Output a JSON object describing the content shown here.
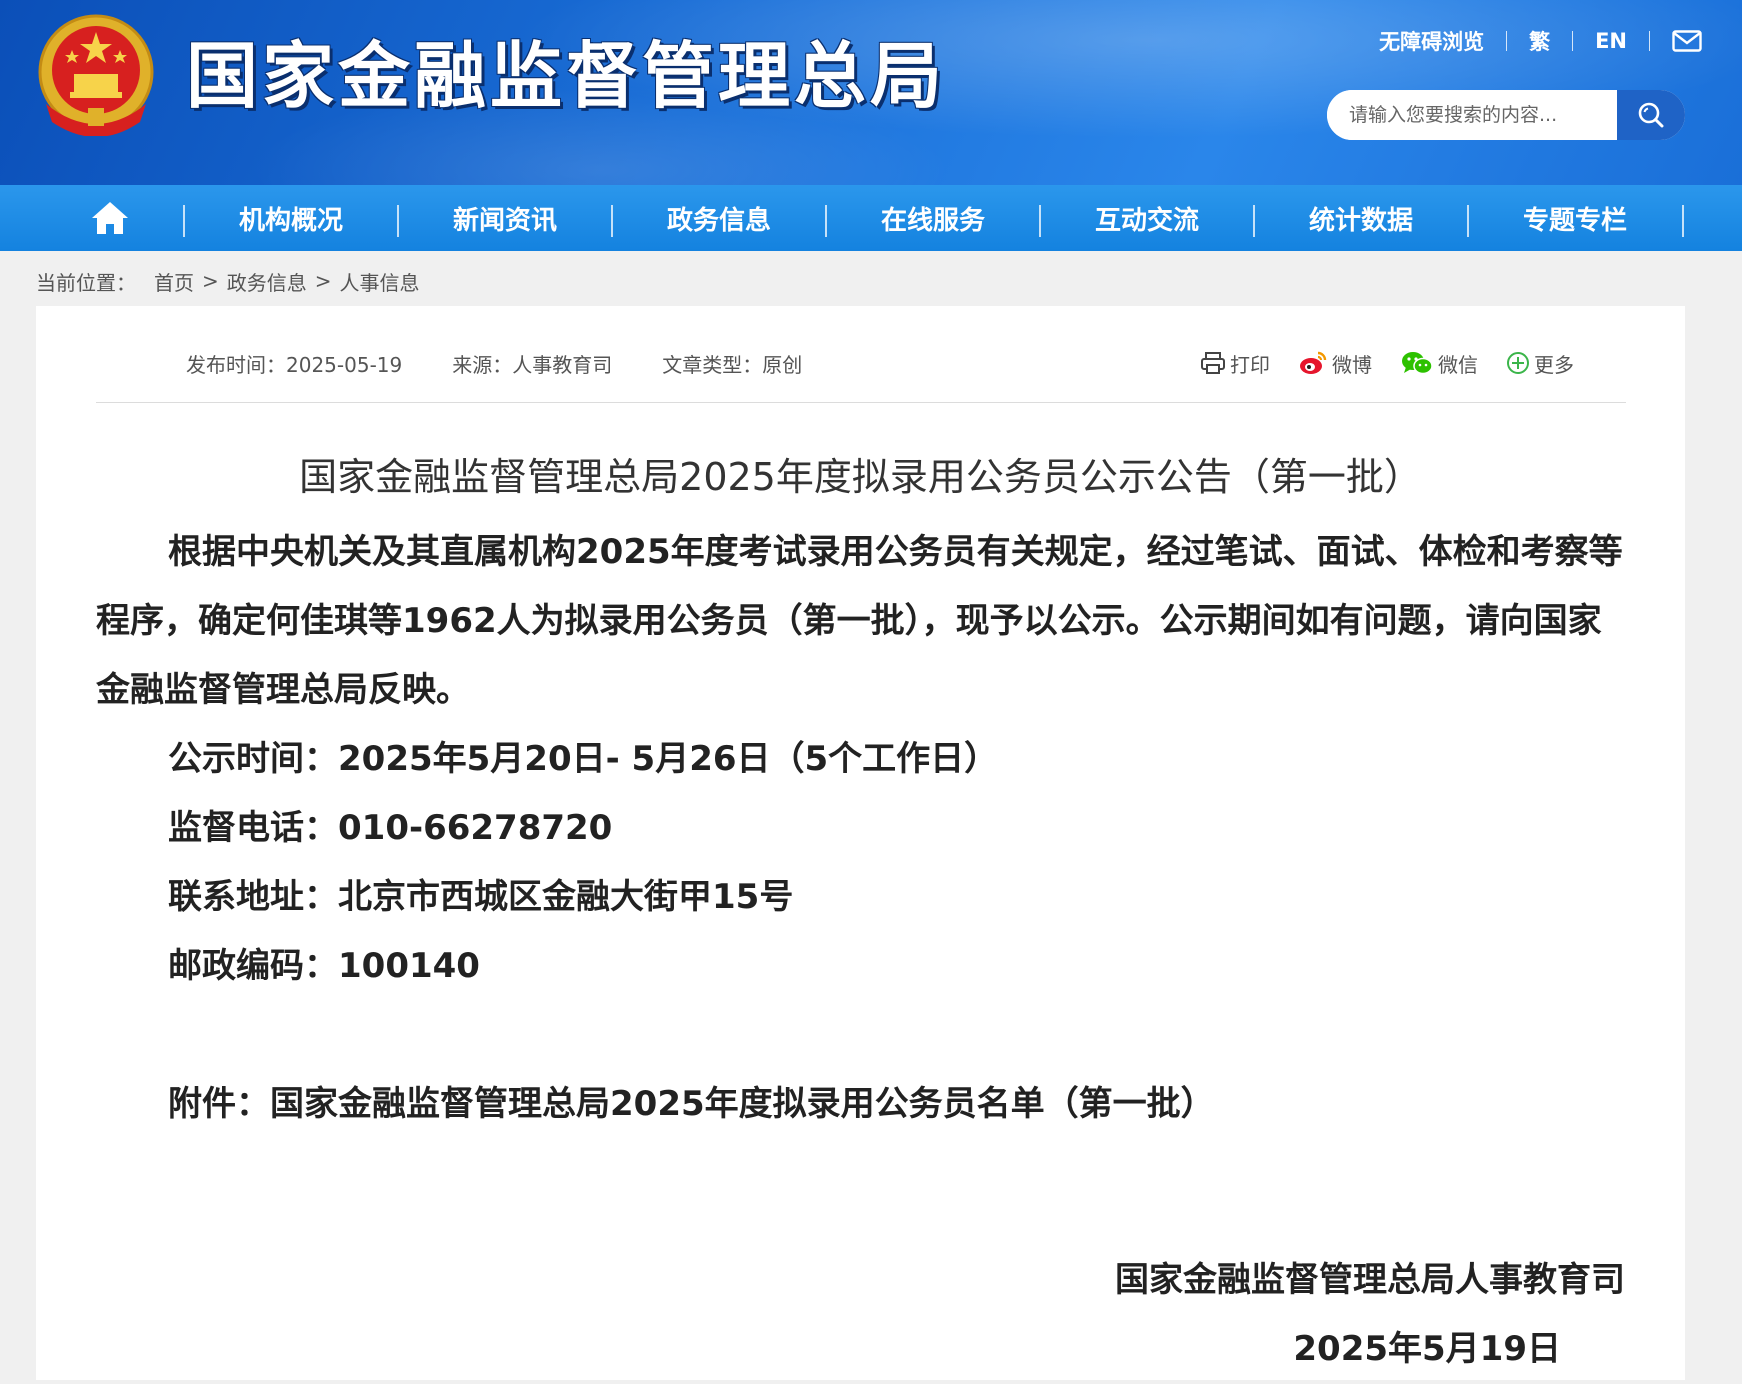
{
  "header": {
    "site_title": "国家金融监督管理总局",
    "links": {
      "accessibility": "无障碍浏览",
      "traditional": "繁",
      "english": "EN"
    },
    "search_placeholder": "请输入您要搜索的内容..."
  },
  "nav": {
    "home_icon": "home-icon",
    "items": [
      "机构概况",
      "新闻资讯",
      "政务信息",
      "在线服务",
      "互动交流",
      "统计数据",
      "专题专栏"
    ]
  },
  "breadcrumb": {
    "label": "当前位置：",
    "items": [
      "首页",
      "政务信息",
      "人事信息"
    ],
    "separator": ">"
  },
  "article": {
    "meta": {
      "publish_time": "发布时间：2025-05-19",
      "source": "来源：人事教育司",
      "type": "文章类型：原创"
    },
    "share": {
      "print": "打印",
      "weibo": "微博",
      "wechat": "微信",
      "more": "更多"
    },
    "title": "国家金融监督管理总局2025年度拟录用公务员公示公告（第一批）",
    "paragraph": "根据中央机关及其直属机构2025年度考试录用公务员有关规定，经过笔试、面试、体检和考察等程序，确定何佳琪等1962人为拟录用公务员（第一批），现予以公示。公示期间如有问题，请向国家金融监督管理总局反映。",
    "lines": [
      "公示时间：2025年5月20日- 5月26日（5个工作日）",
      "监督电话：010-66278720",
      "联系地址：北京市西城区金融大街甲15号",
      "邮政编码：100140"
    ],
    "attachment": "附件：国家金融监督管理总局2025年度拟录用公务员名单（第一批）",
    "signature_org": "国家金融监督管理总局人事教育司",
    "signature_date": "2025年5月19日"
  },
  "colors": {
    "header_blue": "#1a6fd8",
    "nav_blue": "#1a8ae6",
    "search_button": "#1f63c6"
  }
}
